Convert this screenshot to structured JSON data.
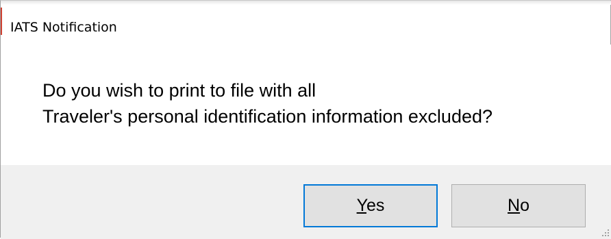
{
  "window": {
    "title": "IATS Notification"
  },
  "message": {
    "line1": "Do you wish to print to file with all",
    "line2": "Traveler's personal identification information excluded?"
  },
  "buttons": {
    "yes": {
      "mnemonic": "Y",
      "rest": "es"
    },
    "no": {
      "mnemonic": "N",
      "rest": "o"
    }
  },
  "colors": {
    "footer_background": "#f0f0f0",
    "button_background": "#e1e1e1",
    "default_button_border": "#0078d7",
    "content_background": "#ffffff"
  },
  "icons": {
    "resize_grip": "size-grip-icon"
  }
}
